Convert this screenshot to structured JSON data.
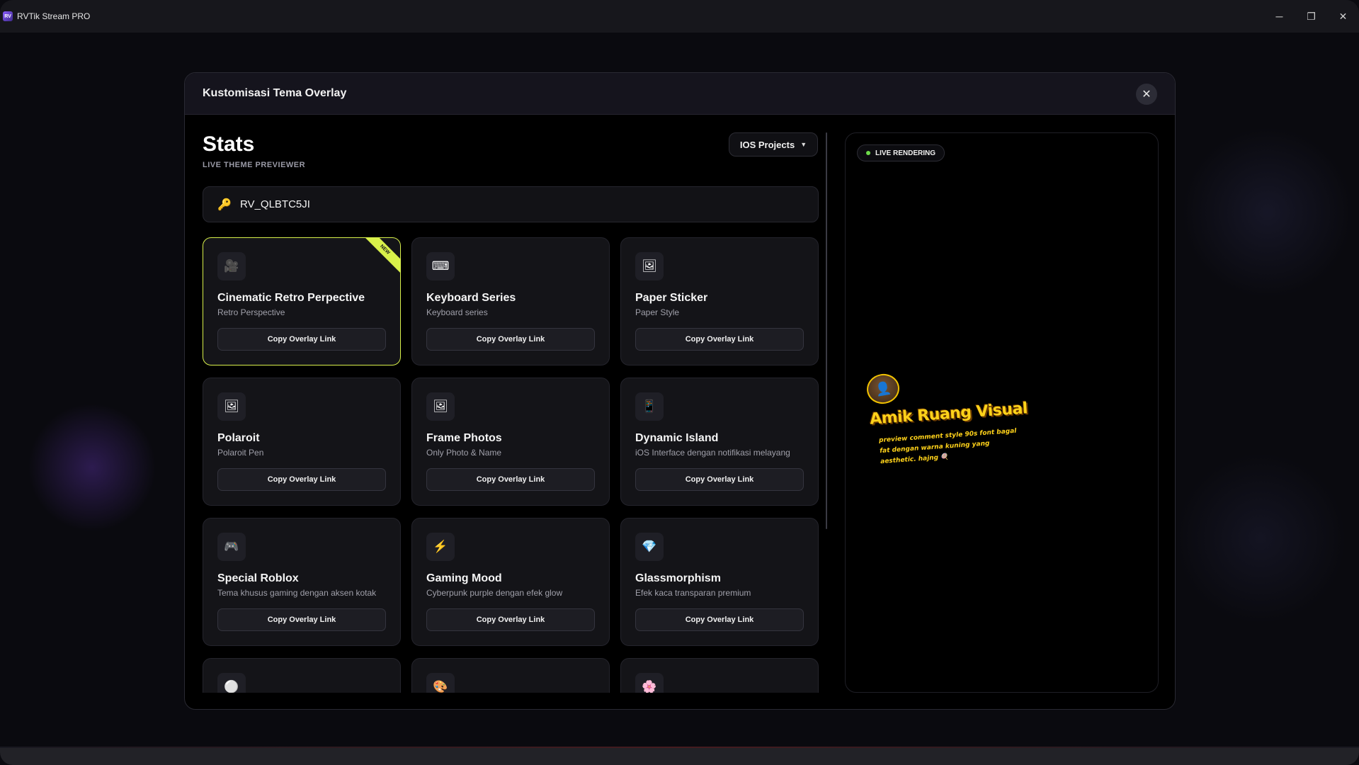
{
  "app": {
    "title": "RVTik Stream PRO",
    "logo_text": "RV"
  },
  "window_controls": {
    "minimize": "─",
    "maximize": "❐",
    "close": "✕"
  },
  "modal": {
    "title": "Kustomisasi Tema Overlay",
    "close_glyph": "✕"
  },
  "stats": {
    "title": "Stats",
    "subtitle": "LIVE THEME PREVIEWER",
    "project_select": "IOS Projects",
    "caret": "▼"
  },
  "key_field": {
    "icon": "🔑",
    "value": "RV_QLBTC5JI"
  },
  "themes": [
    {
      "icon": "🎥",
      "title": "Cinematic Retro Perpective",
      "subtitle": "Retro Perspective",
      "button": "Copy Overlay Link",
      "selected": true,
      "badge": "NEW"
    },
    {
      "icon": "⌨",
      "title": "Keyboard Series",
      "subtitle": "Keyboard series",
      "button": "Copy Overlay Link"
    },
    {
      "icon": "🖼",
      "title": "Paper Sticker",
      "subtitle": "Paper Style",
      "button": "Copy Overlay Link"
    },
    {
      "icon": "🖼",
      "title": "Polaroit",
      "subtitle": "Polaroit Pen",
      "button": "Copy Overlay Link"
    },
    {
      "icon": "🖼",
      "title": "Frame Photos",
      "subtitle": "Only Photo & Name",
      "button": "Copy Overlay Link"
    },
    {
      "icon": "📱",
      "title": "Dynamic Island",
      "subtitle": "iOS Interface dengan notifikasi melayang",
      "button": "Copy Overlay Link"
    },
    {
      "icon": "🎮",
      "title": "Special Roblox",
      "subtitle": "Tema khusus gaming dengan aksen kotak",
      "button": "Copy Overlay Link"
    },
    {
      "icon": "⚡",
      "title": "Gaming Mood",
      "subtitle": "Cyberpunk purple dengan efek glow",
      "button": "Copy Overlay Link"
    },
    {
      "icon": "💎",
      "title": "Glassmorphism",
      "subtitle": "Efek kaca transparan premium",
      "button": "Copy Overlay Link"
    },
    {
      "icon": "⚪",
      "title": "",
      "subtitle": "",
      "button": ""
    },
    {
      "icon": "🎨",
      "title": "",
      "subtitle": "",
      "button": ""
    },
    {
      "icon": "🌸",
      "title": "",
      "subtitle": "",
      "button": ""
    }
  ],
  "preview": {
    "badge": "LIVE RENDERING",
    "overlay_name": "Amik Ruang Visual",
    "overlay_message": "preview comment style 90s font bagal fat dengan warna kuning yang aesthetic. hajng 🍭"
  },
  "colors": {
    "accent": "#d8f04a",
    "live_dot": "#6ddc4a",
    "overlay_text": "#ffd21a",
    "key_icon": "#e8b64a"
  }
}
